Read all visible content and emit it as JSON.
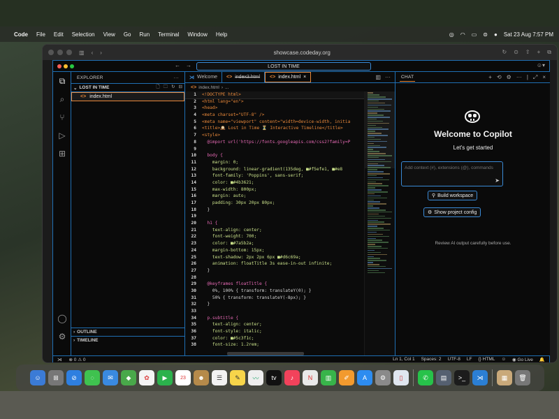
{
  "menubar": {
    "app": "Code",
    "items": [
      "File",
      "Edit",
      "Selection",
      "View",
      "Go",
      "Run",
      "Terminal",
      "Window",
      "Help"
    ],
    "clock": "Sat 23 Aug  7:57 PM"
  },
  "browser": {
    "url": "showcase.codeday.org"
  },
  "vscode": {
    "command_center": "LOST IN TIME",
    "explorer_title": "EXPLORER",
    "folder": "LOST IN TIME",
    "file": "index.html",
    "outline": "OUTLINE",
    "timeline": "TIMELINE",
    "tabs": [
      {
        "label": "Welcome"
      },
      {
        "label": "index3.html"
      },
      {
        "label": "index.html"
      }
    ],
    "breadcrumb": {
      "file": "index.html",
      "rest": "..."
    },
    "code_lines": [
      "<!DOCTYPE html>",
      "<html lang=\"en\">",
      "<head>",
      "<meta charset=\"UTF-8\" />",
      "<meta name=\"viewport\" content=\"width=device-width, initia",
      "<title>🕰️ Lost in Time ⏳ Interactive Timeline</title>",
      "<style>",
      "  @import url('https://fonts.googleapis.com/css2?family=P",
      "",
      "  body {",
      "    margin: 0;",
      "    background: linear-gradient(135deg, ■#f5efe1, ■#e8",
      "    font-family: 'Poppins', sans-serif;",
      "    color: ■#4b3621;",
      "    max-width: 800px;",
      "    margin: auto;",
      "    padding: 30px 20px 80px;",
      "  }",
      "",
      "  h1 {",
      "    text-align: center;",
      "    font-weight: 700;",
      "    color: ■#7a5b2a;",
      "    margin-bottom: 15px;",
      "    text-shadow: 2px 2px 6px ■#d6c69a;",
      "    animation: floatTitle 3s ease-in-out infinite;",
      "  }",
      "",
      "  @keyframes floatTitle {",
      "    0%, 100% { transform: translateY(0); }",
      "    50% { transform: translateY(-8px); }",
      "  }",
      "",
      "  p.subtitle {",
      "    text-align: center;",
      "    font-style: italic;",
      "    color: ■#5c3f1c;",
      "    font-size: 1.2rem;"
    ],
    "chat": {
      "label": "CHAT",
      "welcome": "Welcome to Copilot",
      "subtitle": "Let's get started",
      "input_placeholder": "Add context (#), extensions (@), commands",
      "build_workspace": "Build workspace",
      "show_config": "Show project config",
      "review": "Review AI output carefully before use."
    },
    "status": {
      "errors": "0",
      "warnings": "0",
      "position": "Ln 1, Col 1",
      "spaces": "Spaces: 2",
      "encoding": "UTF-8",
      "eol": "LF",
      "language": "HTML",
      "golive": "Go Live"
    }
  },
  "colors": {
    "accent_blue": "#1f6fb3",
    "accent_orange": "#e8883a"
  }
}
